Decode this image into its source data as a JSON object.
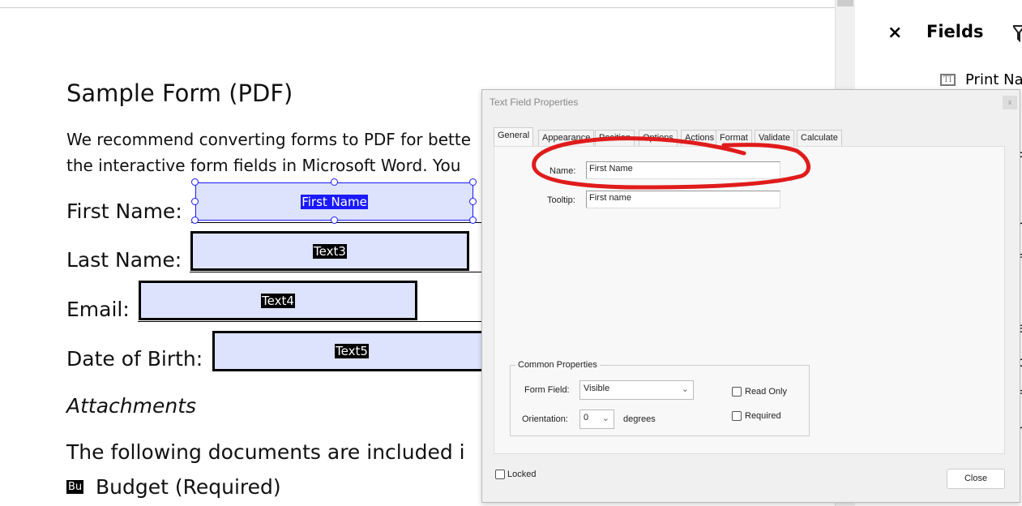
{
  "document": {
    "title": "Sample Form (PDF)",
    "para1": "We recommend converting forms to PDF for bette",
    "para2": "the interactive form fields in Microsoft Word. You",
    "labels": [
      "First Name:",
      "Last Name:",
      "Email:",
      "Date of Birth:"
    ],
    "fields": [
      "First Name",
      "Text3",
      "Text4",
      "Text5"
    ],
    "attachments_heading": "Attachments",
    "para3": "The following documents are included i",
    "budget_icon": "Bu",
    "budget": "Budget (Required)"
  },
  "fields_panel": {
    "title": "Fields",
    "close": "×",
    "item": "Print Na",
    "item_icon": "TI",
    "filter_icon": "filter-icon",
    "letters": [
      "F",
      "J",
      "r",
      "f",
      "e",
      "c",
      "f",
      "r",
      "r"
    ]
  },
  "dialog": {
    "title": "Text Field Properties",
    "close_x": "x",
    "tabs": [
      "General",
      "Appearance",
      "Position",
      "Options",
      "Actions",
      "Format",
      "Validate",
      "Calculate"
    ],
    "active_tab": "General",
    "name_label": "Name:",
    "name_value": "First Name",
    "tooltip_label": "Tooltip:",
    "tooltip_value": "First name",
    "common_title": "Common Properties",
    "form_field_label": "Form Field:",
    "form_field_value": "Visible",
    "orientation_label": "Orientation:",
    "orientation_value": "0",
    "degrees": "degrees",
    "read_only": "Read Only",
    "required": "Required",
    "locked": "Locked",
    "close_button": "Close",
    "annotation_color": "#e01b1b"
  }
}
